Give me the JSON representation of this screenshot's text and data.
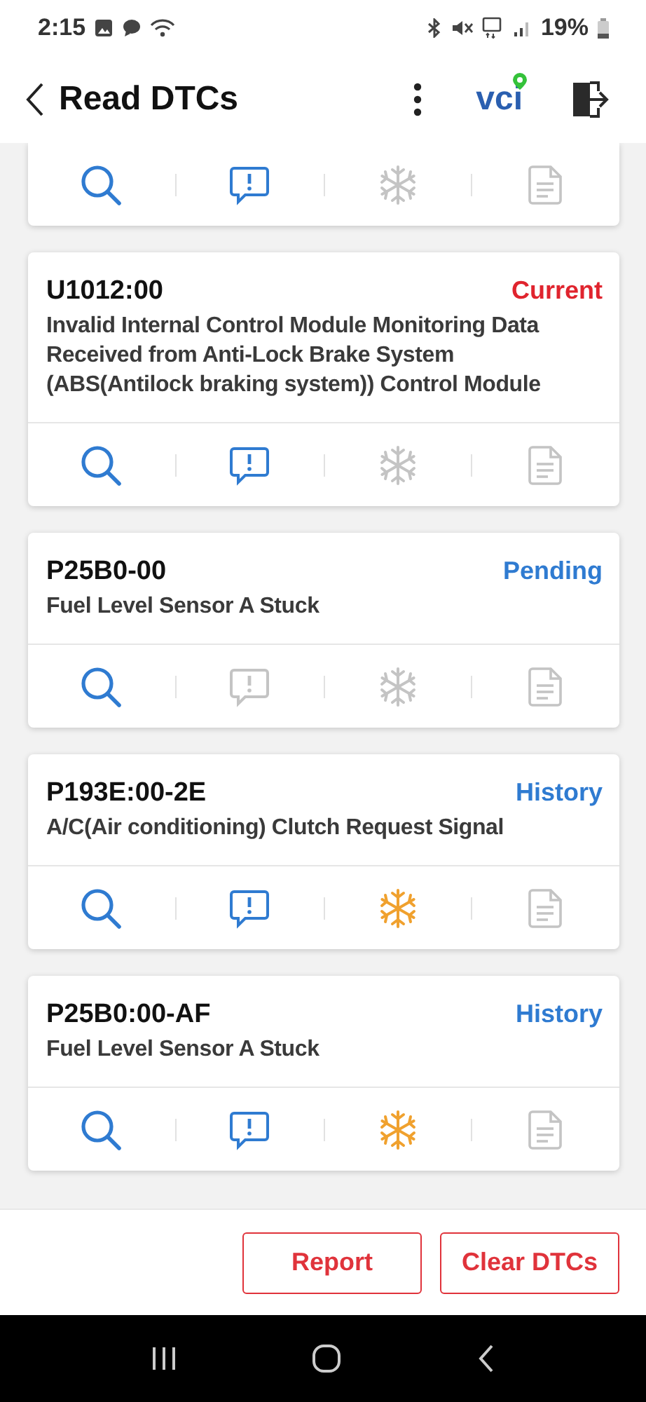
{
  "status_bar": {
    "time": "2:15",
    "battery": "19%"
  },
  "header": {
    "title": "Read DTCs",
    "logo": "vci"
  },
  "dtcs": [
    {
      "kind": "actions_only",
      "actions": [
        {
          "kind": "search",
          "enabled": true
        },
        {
          "kind": "message",
          "enabled": true
        },
        {
          "kind": "freeze",
          "enabled": false
        },
        {
          "kind": "report",
          "enabled": false
        }
      ]
    },
    {
      "code": "U1012:00",
      "status": "Current",
      "color": "#e0242e",
      "kind": "full",
      "description": "Invalid Internal Control Module Monitoring Data Received from Anti-Lock Brake System (ABS(Antilock braking system)) Control Module",
      "actions": [
        {
          "kind": "search",
          "enabled": true
        },
        {
          "kind": "message",
          "enabled": true
        },
        {
          "kind": "freeze",
          "enabled": false
        },
        {
          "kind": "report",
          "enabled": false
        }
      ]
    },
    {
      "code": "P25B0-00",
      "status": "Pending",
      "color": "#2f7bd1",
      "kind": "full",
      "description": "Fuel Level Sensor A Stuck",
      "actions": [
        {
          "kind": "search",
          "enabled": true
        },
        {
          "kind": "message",
          "enabled": false
        },
        {
          "kind": "freeze",
          "enabled": false
        },
        {
          "kind": "report",
          "enabled": false
        }
      ]
    },
    {
      "code": "P193E:00-2E",
      "status": "History",
      "color": "#2f7bd1",
      "kind": "full",
      "description": "A/C(Air conditioning) Clutch Request Signal",
      "actions": [
        {
          "kind": "search",
          "enabled": true
        },
        {
          "kind": "message",
          "enabled": true
        },
        {
          "kind": "freeze",
          "enabled": true
        },
        {
          "kind": "report",
          "enabled": false
        }
      ]
    },
    {
      "code": "P25B0:00-AF",
      "status": "History",
      "color": "#2f7bd1",
      "kind": "full",
      "description": "Fuel Level Sensor A Stuck",
      "actions": [
        {
          "kind": "search",
          "enabled": true
        },
        {
          "kind": "message",
          "enabled": true
        },
        {
          "kind": "freeze",
          "enabled": true
        },
        {
          "kind": "report",
          "enabled": false
        }
      ]
    }
  ],
  "footer": {
    "buttons": [
      "Report",
      "Clear DTCs"
    ]
  }
}
